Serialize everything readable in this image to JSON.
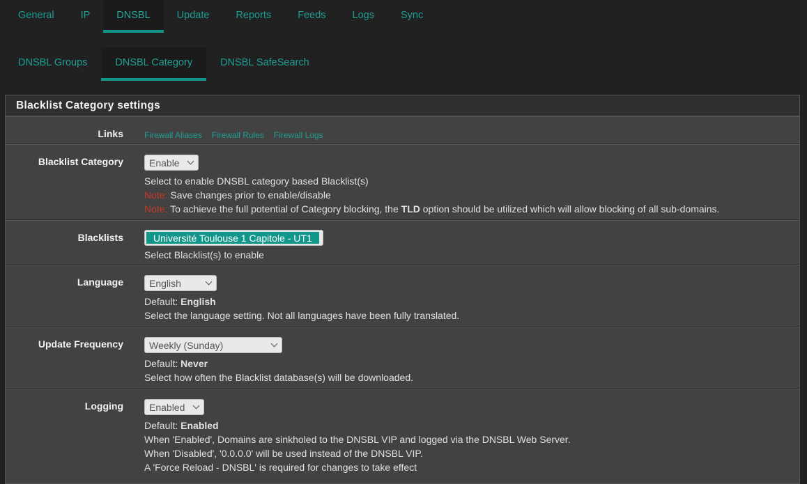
{
  "main_tabs": [
    "General",
    "IP",
    "DNSBL",
    "Update",
    "Reports",
    "Feeds",
    "Logs",
    "Sync"
  ],
  "sub_tabs": [
    "DNSBL Groups",
    "DNSBL Category",
    "DNSBL SafeSearch"
  ],
  "panel": {
    "title": "Blacklist Category settings",
    "links": {
      "label": "Links",
      "items": [
        "Firewall Aliases",
        "Firewall Rules",
        "Firewall Logs"
      ]
    },
    "blacklist_category": {
      "label": "Blacklist Category",
      "value": "Enable",
      "help1": "Select to enable DNSBL category based Blacklist(s)",
      "note_label": "Note:",
      "note1": "Save changes prior to enable/disable",
      "note2_pre": "To achieve the full potential of Category blocking, the ",
      "note2_bold": "TLD",
      "note2_post": " option should be utilized which will allow blocking of all sub-domains."
    },
    "blacklists": {
      "label": "Blacklists",
      "selected": "Université Toulouse 1 Capitole - UT1",
      "help": "Select Blacklist(s) to enable"
    },
    "language": {
      "label": "Language",
      "value": "English",
      "default_label": "Default: ",
      "default_value": "English",
      "help": "Select the language setting. Not all languages have been fully translated."
    },
    "update_frequency": {
      "label": "Update Frequency",
      "value": "Weekly (Sunday)",
      "default_label": "Default: ",
      "default_value": "Never",
      "help": "Select how often the Blacklist database(s) will be downloaded."
    },
    "logging": {
      "label": "Logging",
      "value": "Enabled",
      "default_label": "Default: ",
      "default_value": "Enabled",
      "help1": "When 'Enabled', Domains are sinkholed to the DNSBL VIP and logged via the DNSBL Web Server.",
      "help2": "When 'Disabled', '0.0.0.0' will be used instead of the DNSBL VIP.",
      "help3": "A 'Force Reload - DNSBL' is required for changes to take effect"
    }
  },
  "colors": {
    "accent": "#12968a",
    "background": "#212121",
    "panel": "#424242",
    "note": "#c0392b"
  }
}
